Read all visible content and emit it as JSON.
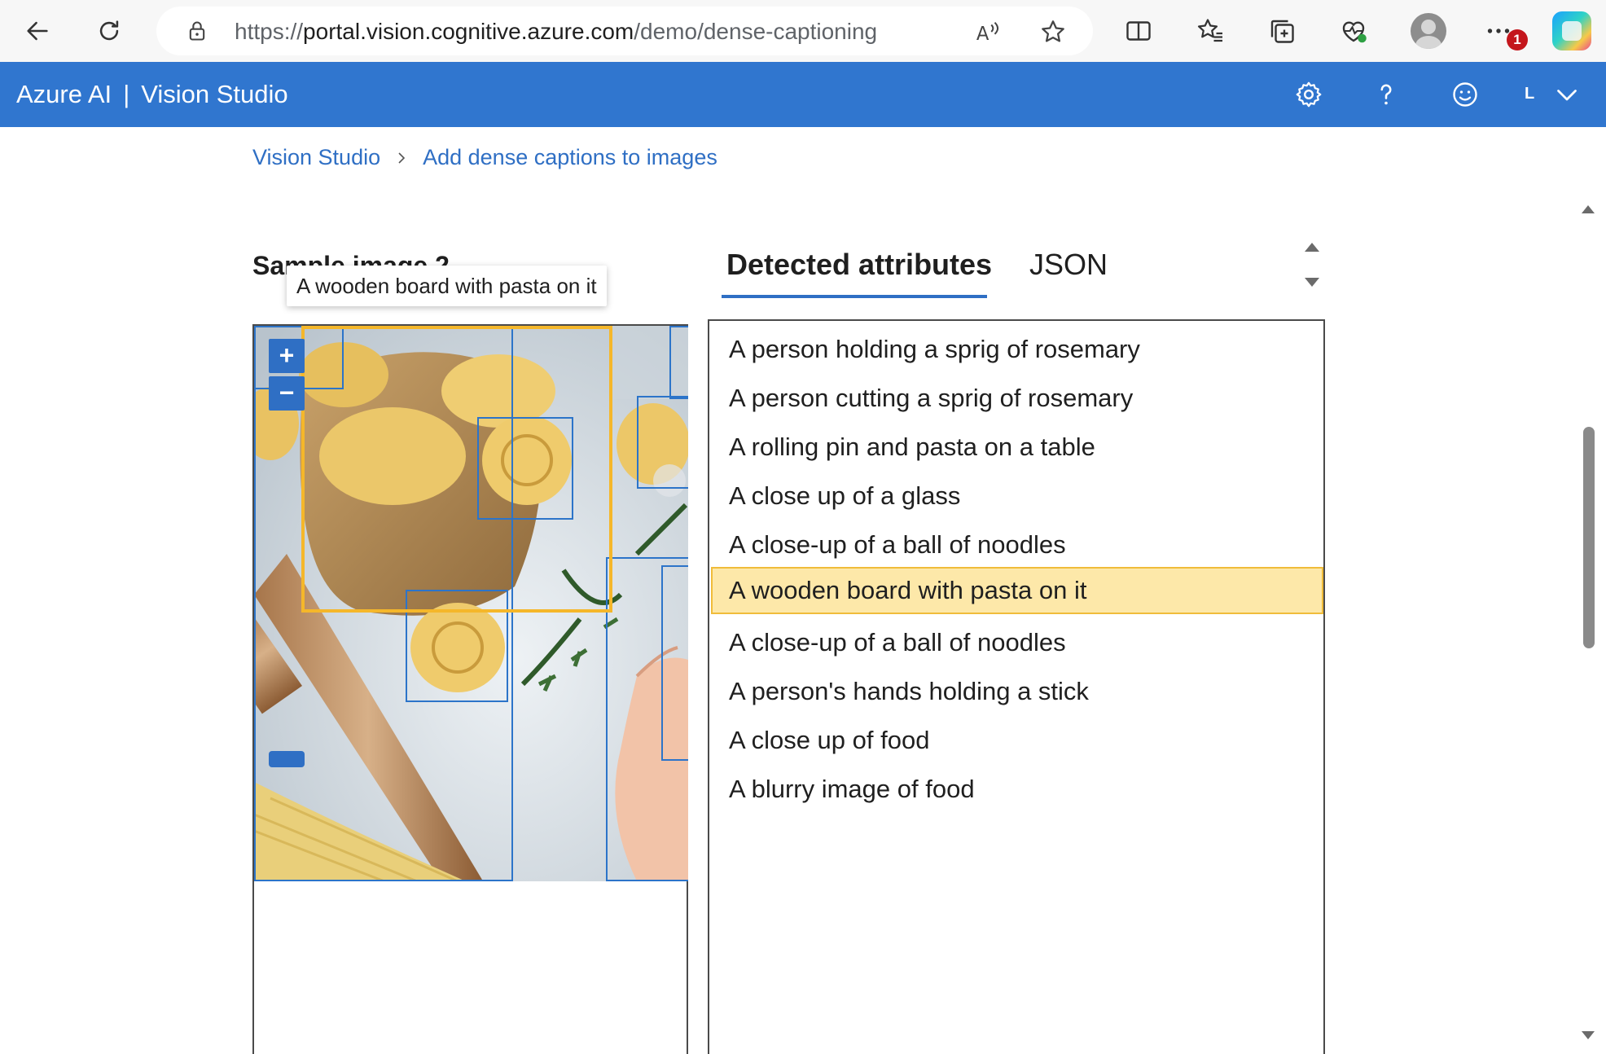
{
  "browser": {
    "url_scheme": "https://",
    "url_host": "portal.vision.cognitive.azure.com",
    "url_path": "/demo/dense-captioning",
    "notification_count": "1"
  },
  "header": {
    "brand": "Azure AI",
    "separator": "|",
    "product": "Vision Studio",
    "user_initial": "L"
  },
  "breadcrumb": {
    "items": [
      "Vision Studio",
      "Add dense captions to images"
    ]
  },
  "sample": {
    "title": "Sample image 2",
    "tooltip": "A wooden board with pasta on it",
    "zoom_in": "+",
    "zoom_out": "−"
  },
  "tabs": [
    {
      "label": "Detected attributes",
      "active": true
    },
    {
      "label": "JSON",
      "active": false
    }
  ],
  "attributes": [
    "A person holding a sprig of rosemary",
    "A person cutting a sprig of rosemary",
    "A rolling pin and pasta on a table",
    "A close up of a glass",
    "A close-up of a ball of noodles",
    "A wooden board with pasta on it",
    "A close-up of a ball of noodles",
    "A person's hands holding a stick",
    "A close up of food",
    "A blurry image of food"
  ],
  "selected_attribute_index": 5,
  "colors": {
    "header": "#3076cf",
    "link": "#2f6fc4",
    "selection": "#fde8a9",
    "selection_border": "#f0bc3a",
    "bbox": "#2c74c9",
    "bbox_active": "#f5b72a"
  }
}
